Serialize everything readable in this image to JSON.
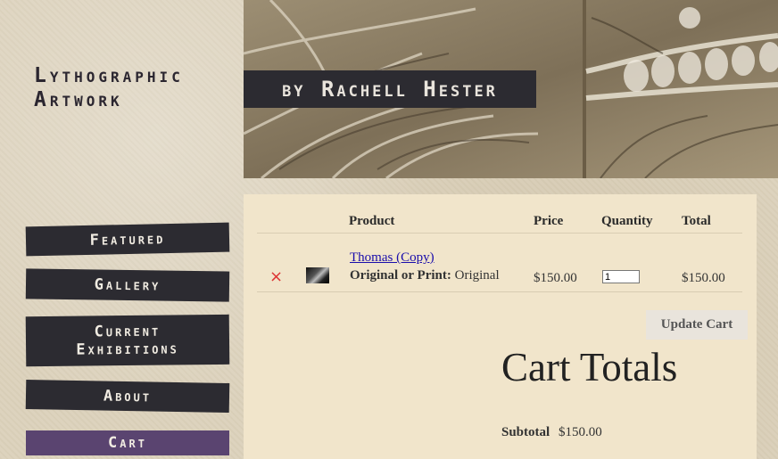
{
  "site": {
    "title_line1": "Lythographic",
    "title_line2": "Artwork",
    "byline": "by Rachell Hester"
  },
  "nav": {
    "items": [
      {
        "label": "Featured"
      },
      {
        "label": "Gallery"
      },
      {
        "label_line1": "Current",
        "label_line2": "Exhibitions"
      },
      {
        "label": "About"
      },
      {
        "label": "Cart"
      }
    ]
  },
  "cart": {
    "headers": {
      "product": "Product",
      "price": "Price",
      "quantity": "Quantity",
      "total": "Total"
    },
    "items": [
      {
        "remove_symbol": "×",
        "name": "Thomas (Copy)",
        "variation_label": "Original or Print:",
        "variation_value": "Original",
        "price": "$150.00",
        "quantity": "1",
        "total": "$150.00"
      }
    ],
    "update_label": "Update Cart"
  },
  "totals": {
    "title": "Cart Totals",
    "subtotal_label": "Subtotal",
    "subtotal_value": "$150.00"
  },
  "colors": {
    "nav_bg": "#2c2b31",
    "nav_active": "#5a4470",
    "content_bg": "#f1e5cb",
    "page_bg": "#dcd2bc",
    "link": "#1a0dab",
    "remove": "#dd3333"
  }
}
